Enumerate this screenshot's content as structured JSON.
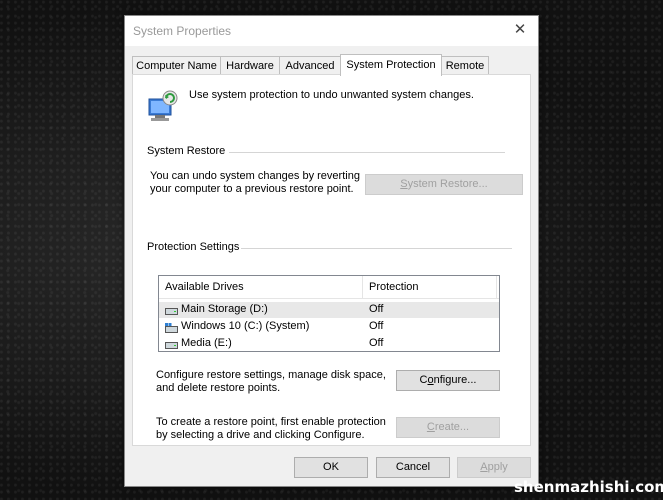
{
  "window": {
    "title": "System Properties",
    "close_glyph": "✕"
  },
  "tabs": [
    {
      "label": "Computer Name"
    },
    {
      "label": "Hardware"
    },
    {
      "label": "Advanced"
    },
    {
      "label": "System Protection",
      "active": true
    },
    {
      "label": "Remote"
    }
  ],
  "intro": {
    "icon": "system-protection-icon",
    "text": "Use system protection to undo unwanted system changes."
  },
  "system_restore": {
    "group_label": "System Restore",
    "description_line1": "You can undo system changes by reverting",
    "description_line2": "your computer to a previous restore point.",
    "button_label_prefix": "",
    "button_accel": "S",
    "button_label_rest": "ystem Restore..."
  },
  "protection_settings": {
    "group_label": "Protection Settings",
    "columns": [
      "Available Drives",
      "Protection"
    ],
    "drives": [
      {
        "name": "Main Storage (D:)",
        "protection": "Off",
        "icon": "drive-icon",
        "selected": true
      },
      {
        "name": "Windows 10 (C:) (System)",
        "protection": "Off",
        "icon": "system-drive-icon"
      },
      {
        "name": "Media (E:)",
        "protection": "Off",
        "icon": "drive-icon"
      }
    ],
    "configure_desc_line1": "Configure restore settings, manage disk space,",
    "configure_desc_line2": "and delete restore points.",
    "configure_button_prefix": "C",
    "configure_button_accel": "o",
    "configure_button_rest": "nfigure...",
    "create_desc_line1": "To create a restore point, first enable protection",
    "create_desc_line2": "by selecting a drive and clicking Configure.",
    "create_button_prefix": "",
    "create_button_accel": "C",
    "create_button_rest": "reate..."
  },
  "footer": {
    "ok": "OK",
    "cancel": "Cancel",
    "apply_prefix": "",
    "apply_accel": "A",
    "apply_rest": "pply"
  },
  "watermark": "shenmazhishi.com",
  "colors": {
    "panel_bg": "#ffffff",
    "dialog_bg": "#f0f0f0",
    "button_bg": "#e1e1e1",
    "disabled_text": "#a0a0a0"
  }
}
